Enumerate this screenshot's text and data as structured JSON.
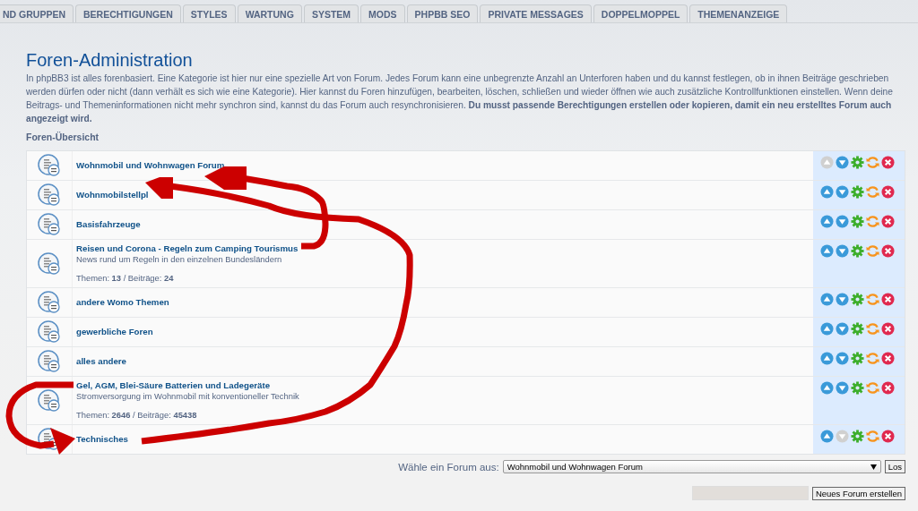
{
  "tabs": [
    {
      "label": "ND GRUPPEN",
      "selected": false
    },
    {
      "label": "BERECHTIGUNGEN",
      "selected": false
    },
    {
      "label": "STYLES",
      "selected": false
    },
    {
      "label": "WARTUNG",
      "selected": false
    },
    {
      "label": "SYSTEM",
      "selected": false
    },
    {
      "label": "MODS",
      "selected": false
    },
    {
      "label": "PHPBB SEO",
      "selected": false
    },
    {
      "label": "PRIVATE MESSAGES",
      "selected": false
    },
    {
      "label": "DOPPELMOPPEL",
      "selected": false
    },
    {
      "label": "THEMENANZEIGE",
      "selected": false
    }
  ],
  "page": {
    "title": "Foren-Administration",
    "intro": "In phpBB3 ist alles forenbasiert. Eine Kategorie ist hier nur eine spezielle Art von Forum. Jedes Forum kann eine unbegrenzte Anzahl an Unterforen haben und du kannst festlegen, ob in ihnen Beiträge geschrieben werden dürfen oder nicht (dann verhält es sich wie eine Kategorie). Hier kannst du Foren hinzufügen, bearbeiten, löschen, schließen und wieder öffnen wie auch zusätzliche Kontrollfunktionen einstellen. Wenn deine Beitrags- und Themeninformationen nicht mehr synchron sind, kannst du das Forum auch resynchronisieren. **Du musst passende Berechtigungen erstellen oder kopieren, damit ein neu erstelltes Forum auch angezeigt wird.**",
    "section": "Foren-Übersicht"
  },
  "forums": [
    {
      "name": "Wohnmobil und Wohnwagen Forum",
      "move_up_disabled": true,
      "move_down_disabled": false
    },
    {
      "name": "Wohnmobilstellpl",
      "move_up_disabled": false,
      "move_down_disabled": false
    },
    {
      "name": "Basisfahrzeuge",
      "move_up_disabled": false,
      "move_down_disabled": false
    },
    {
      "name": "Reisen und Corona - Regeln zum Camping Tourismus",
      "description": "News rund um Regeln in den einzelnen Bundesländern",
      "stats": "Themen: **13** / Beiträge: **24**",
      "move_up_disabled": false,
      "move_down_disabled": false
    },
    {
      "name": "andere Womo Themen",
      "move_up_disabled": false,
      "move_down_disabled": false
    },
    {
      "name": "gewerbliche Foren",
      "move_up_disabled": false,
      "move_down_disabled": false
    },
    {
      "name": "alles andere",
      "move_up_disabled": false,
      "move_down_disabled": false
    },
    {
      "name": "Gel, AGM, Blei-Säure Batterien und Ladegeräte",
      "description": "Stromversorgung im Wohnmobil mit konventioneller Technik",
      "stats": "Themen: **2646** / Beiträge: **45438**",
      "move_up_disabled": false,
      "move_down_disabled": false
    },
    {
      "name": "Technisches",
      "move_up_disabled": false,
      "move_down_disabled": true
    }
  ],
  "jump": {
    "label": "Wähle ein Forum aus:",
    "value": "Wohnmobil und Wohnwagen Forum",
    "button": "Los"
  },
  "create": {
    "button": "Neues Forum erstellen"
  }
}
